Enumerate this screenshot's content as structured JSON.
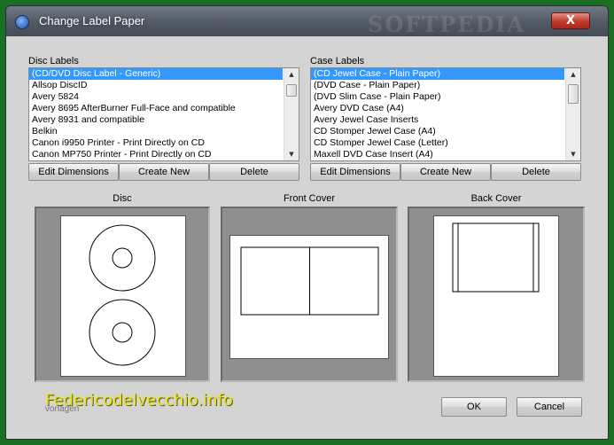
{
  "window": {
    "title": "Change Label Paper",
    "watermark_top": "SOFTPEDIA",
    "close_label": "X"
  },
  "disc_labels": {
    "label": "Disc Labels",
    "items": [
      "(CD/DVD Disc Label - Generic)",
      "Allsop  DiscID",
      "Avery 5824",
      "Avery 8695 AfterBurner Full-Face and compatible",
      "Avery 8931 and compatible",
      "Belkin",
      "Canon i9950 Printer - Print Directly on CD",
      "Canon MP750 Printer - Print Directly on CD"
    ],
    "selected_index": 0,
    "buttons": {
      "edit": "Edit Dimensions",
      "new": "Create New",
      "delete": "Delete"
    }
  },
  "case_labels": {
    "label": "Case Labels",
    "items": [
      "(CD Jewel Case - Plain Paper)",
      "(DVD Case - Plain Paper)",
      "(DVD Slim Case - Plain Paper)",
      "Avery DVD Case (A4)",
      "Avery Jewel Case Inserts",
      "CD Stomper Jewel Case (A4)",
      "CD Stomper Jewel Case (Letter)",
      "Maxell DVD Case Insert (A4)"
    ],
    "selected_index": 0,
    "buttons": {
      "edit": "Edit Dimensions",
      "new": "Create New",
      "delete": "Delete"
    }
  },
  "previews": {
    "disc": "Disc",
    "front_cover": "Front Cover",
    "back_cover": "Back Cover"
  },
  "footer": {
    "ok": "OK",
    "cancel": "Cancel",
    "watermark": "Federicodelvecchio.info",
    "watermark_sub": "vorlagen"
  },
  "icons": {
    "scroll_up": "scroll-up-arrow",
    "scroll_down": "scroll-down-arrow",
    "app": "app-disc-icon"
  },
  "colors": {
    "selection": "#3399ff",
    "page_background": "#1b6f22",
    "watermark": "#e6e31b"
  }
}
